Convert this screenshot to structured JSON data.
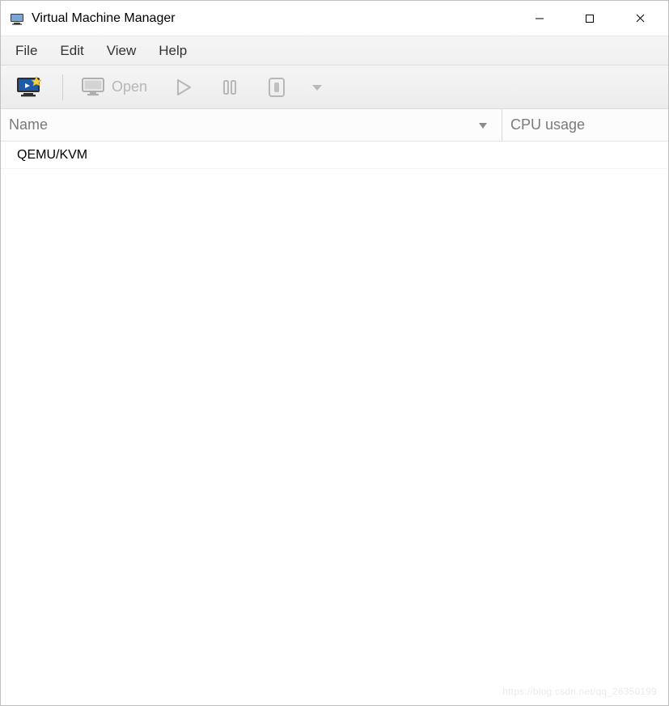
{
  "window": {
    "title": "Virtual Machine Manager"
  },
  "menubar": {
    "file": "File",
    "edit": "Edit",
    "view": "View",
    "help": "Help"
  },
  "toolbar": {
    "open_label": "Open"
  },
  "columns": {
    "name": "Name",
    "cpu": "CPU usage"
  },
  "connections": [
    {
      "label": "QEMU/KVM"
    }
  ],
  "watermark": "https://blog.csdn.net/qq_26350199"
}
